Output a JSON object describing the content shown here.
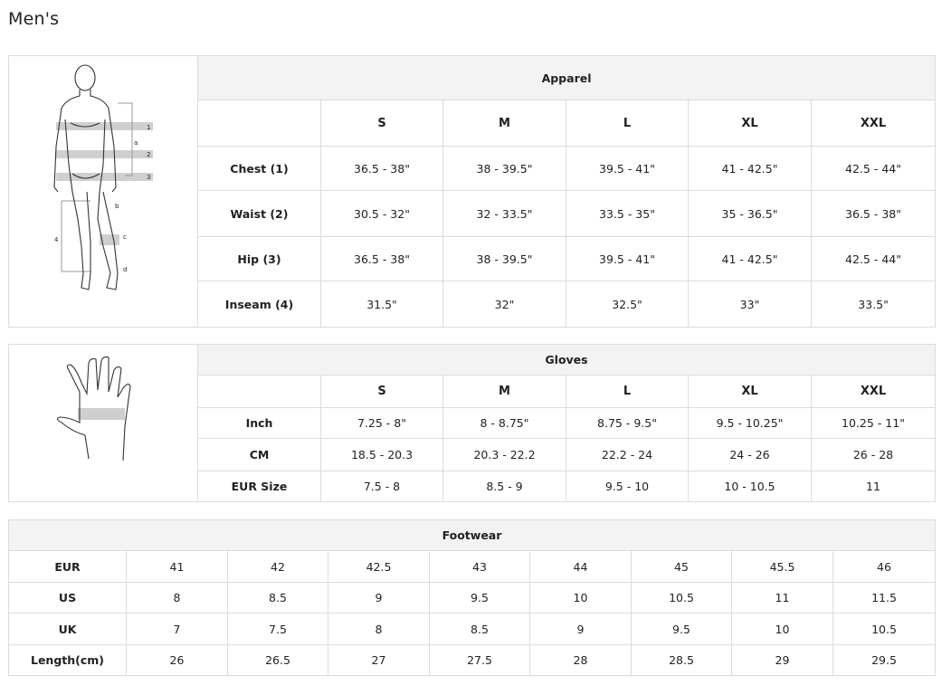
{
  "page": {
    "title": "Men's"
  },
  "apparel": {
    "title": "Apparel",
    "sizes": [
      "S",
      "M",
      "L",
      "XL",
      "XXL"
    ],
    "rows": [
      {
        "label": "Chest (1)",
        "values": [
          "36.5 - 38\"",
          "38 - 39.5\"",
          "39.5 - 41\"",
          "41 - 42.5\"",
          "42.5 - 44\""
        ]
      },
      {
        "label": "Waist (2)",
        "values": [
          "30.5 - 32\"",
          "32 - 33.5\"",
          "33.5 - 35\"",
          "35 - 36.5\"",
          "36.5 - 38\""
        ]
      },
      {
        "label": "Hip (3)",
        "values": [
          "36.5 - 38\"",
          "38 - 39.5\"",
          "39.5 - 41\"",
          "41 - 42.5\"",
          "42.5 - 44\""
        ]
      },
      {
        "label": "Inseam (4)",
        "values": [
          "31.5\"",
          "32\"",
          "32.5\"",
          "33\"",
          "33.5\""
        ]
      }
    ],
    "figure_labels": {
      "m1": "1",
      "m2": "2",
      "m3": "3",
      "m4": "4",
      "a": "a",
      "b": "b",
      "c": "c",
      "d": "d"
    }
  },
  "gloves": {
    "title": "Gloves",
    "sizes": [
      "S",
      "M",
      "L",
      "XL",
      "XXL"
    ],
    "rows": [
      {
        "label": "Inch",
        "values": [
          "7.25 - 8\"",
          "8 - 8.75\"",
          "8.75 - 9.5\"",
          "9.5 - 10.25\"",
          "10.25 - 11\""
        ]
      },
      {
        "label": "CM",
        "values": [
          "18.5 - 20.3",
          "20.3 - 22.2",
          "22.2 - 24",
          "24 - 26",
          "26 - 28"
        ]
      },
      {
        "label": "EUR Size",
        "values": [
          "7.5 - 8",
          "8.5 - 9",
          "9.5 - 10",
          "10 - 10.5",
          "11"
        ]
      }
    ]
  },
  "footwear": {
    "title": "Footwear",
    "rows": [
      {
        "label": "EUR",
        "values": [
          "41",
          "42",
          "42.5",
          "43",
          "44",
          "45",
          "45.5",
          "46"
        ]
      },
      {
        "label": "US",
        "values": [
          "8",
          "8.5",
          "9",
          "9.5",
          "10",
          "10.5",
          "11",
          "11.5"
        ]
      },
      {
        "label": "UK",
        "values": [
          "7",
          "7.5",
          "8",
          "8.5",
          "9",
          "9.5",
          "10",
          "10.5"
        ]
      },
      {
        "label": "Length(cm)",
        "values": [
          "26",
          "26.5",
          "27",
          "27.5",
          "28",
          "28.5",
          "29",
          "29.5"
        ]
      }
    ]
  },
  "colors": {
    "border": "#dcdcdc",
    "header_bg": "#f3f3f3",
    "band": "#cfcfcf"
  }
}
